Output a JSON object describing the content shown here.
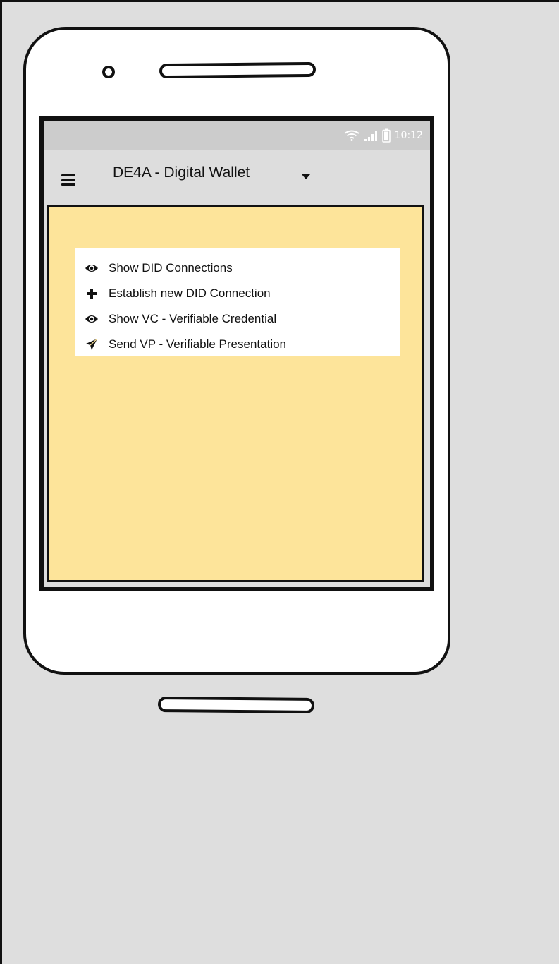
{
  "status_bar": {
    "time": "10:12",
    "icons": [
      "wifi-icon",
      "signal-icon",
      "battery-icon"
    ]
  },
  "app_bar": {
    "menu_icon": "hamburger-icon",
    "title": "DE4A - Digital Wallet",
    "dropdown_icon": "caret-down-icon"
  },
  "menu": {
    "items": [
      {
        "label": "Show DID Connections",
        "icon": "eye-icon"
      },
      {
        "label": "Establish new DID Connection",
        "icon": "plus-icon"
      },
      {
        "label": "Show VC - Verifiable Credential",
        "icon": "eye-icon"
      },
      {
        "label": "Send VP - Verifiable Presentation",
        "icon": "send-icon"
      }
    ]
  },
  "colors": {
    "content_background": "#fde49a",
    "status_bar": "#cccccc",
    "app_bar": "#dddddd",
    "canvas": "#dedede"
  }
}
